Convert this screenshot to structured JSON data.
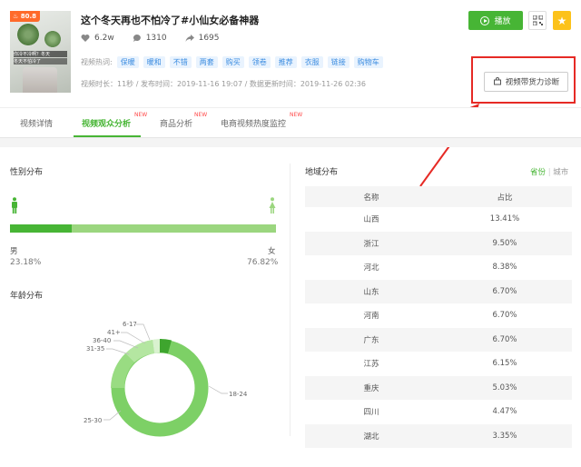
{
  "video": {
    "heat_score": "80.8",
    "thumb_text_a": "你冷不冷啊？冬天",
    "thumb_text_b": "冬天不怕冷了",
    "title": "这个冬天再也不怕冷了#小仙女必备神器",
    "likes": "6.2w",
    "comments": "1310",
    "shares": "1695",
    "hot_words_label": "视频热词:",
    "hot_words": [
      "保暖",
      "暖和",
      "不错",
      "两套",
      "购买",
      "领卷",
      "推荐",
      "衣服",
      "链接",
      "购物车"
    ],
    "meta": "视频时长：11秒 / 发布时间：2019-11-16 19:07 / 数据更新时间：2019-11-26 02:36"
  },
  "actions": {
    "play_label": "播放",
    "diagnose_label": "视频带货力诊断"
  },
  "tabs": [
    {
      "label": "视频详情",
      "new": ""
    },
    {
      "label": "视频观众分析",
      "new": "NEW"
    },
    {
      "label": "商品分析",
      "new": "NEW"
    },
    {
      "label": "电商视频热度监控",
      "new": "NEW"
    }
  ],
  "gender": {
    "title": "性别分布",
    "male_label": "男",
    "female_label": "女",
    "male_pct": "23.18%",
    "female_pct": "76.82%",
    "male_fraction": 0.2318
  },
  "age": {
    "title": "年龄分布",
    "labels": [
      "6-17",
      "41+",
      "36-40",
      "31-35",
      "25-30",
      "18-24"
    ]
  },
  "region": {
    "title": "地域分布",
    "toggle_province": "省份",
    "toggle_city": "城市",
    "col_name": "名称",
    "col_pct": "占比",
    "rows": [
      {
        "name": "山西",
        "pct": "13.41%"
      },
      {
        "name": "浙江",
        "pct": "9.50%"
      },
      {
        "name": "河北",
        "pct": "8.38%"
      },
      {
        "name": "山东",
        "pct": "6.70%"
      },
      {
        "name": "河南",
        "pct": "6.70%"
      },
      {
        "name": "广东",
        "pct": "6.70%"
      },
      {
        "name": "江苏",
        "pct": "6.15%"
      },
      {
        "name": "重庆",
        "pct": "5.03%"
      },
      {
        "name": "四川",
        "pct": "4.47%"
      },
      {
        "name": "湖北",
        "pct": "3.35%"
      }
    ]
  },
  "colors": {
    "accent": "#47b535",
    "annotation": "#e62a25",
    "heat_badge": "#ff6a2a"
  }
}
